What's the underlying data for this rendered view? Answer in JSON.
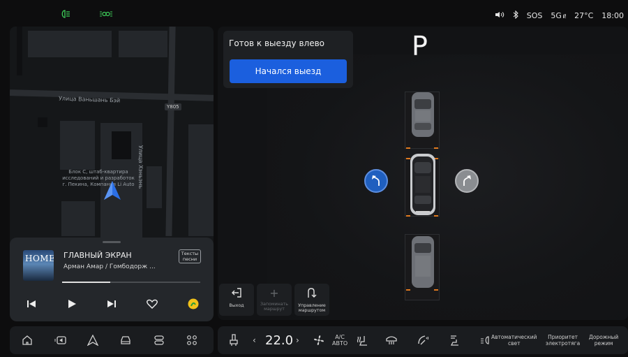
{
  "status_bar": {
    "left_icons": [
      "headlights-icon",
      "parking-lights-icon"
    ],
    "volume_icon": "volume-icon",
    "bluetooth_icon": "bluetooth-icon",
    "sos": "SOS",
    "network": "5G",
    "temperature": "27°C",
    "time": "18:00"
  },
  "map": {
    "street_1": "Улица Ваньшань Бэй",
    "street_2": "Улица Хэньэнь",
    "road_shield": "Y805",
    "poi_label": "Блок С, штаб-квартира исследований и разработок г. Пекина, Компания Li Auto"
  },
  "media": {
    "album_art_text": "HOME",
    "title": "ГЛАВНЫЙ ЭКРАН",
    "artist": "Арман Амар / Гомбодорж ...",
    "lyrics_button": "Тексты песни",
    "progress": 0.35
  },
  "parking": {
    "status_title": "Готов к выезду влево",
    "start_button": "Начался выезд",
    "gear": "P",
    "actions": [
      {
        "icon": "exit-icon",
        "glyph": "⇤",
        "label": "Выход",
        "disabled": false
      },
      {
        "icon": "plus-icon",
        "glyph": "+",
        "label": "Запоминать маршрут",
        "disabled": true
      },
      {
        "icon": "route-icon",
        "glyph": "⮌",
        "label": "Управление маршрутом",
        "disabled": false
      }
    ]
  },
  "dock": {
    "items": [
      "home-icon",
      "media-icon",
      "navigation-icon",
      "car-icon",
      "controls-icon",
      "apps-icon"
    ]
  },
  "climate": {
    "temperature": "22.0",
    "temp_unit": "",
    "ac_label_top": "A/C",
    "ac_label_bottom": "АВТО",
    "auto_light_line1": "Автоматический",
    "auto_light_line2": "свет",
    "priority_line1": "Приоритет",
    "priority_line2": "электротяга",
    "road_mode_line1": "Дорожный",
    "road_mode_line2": "режим"
  },
  "colors": {
    "accent_blue": "#1b5fde",
    "steer_left_blue": "#1f5fbf",
    "steer_right_gray": "#8a8d91",
    "parking_marker": "#e07a1f",
    "nav_arrow_blue": "#2b6fe6",
    "status_green": "#3ecf5a"
  }
}
